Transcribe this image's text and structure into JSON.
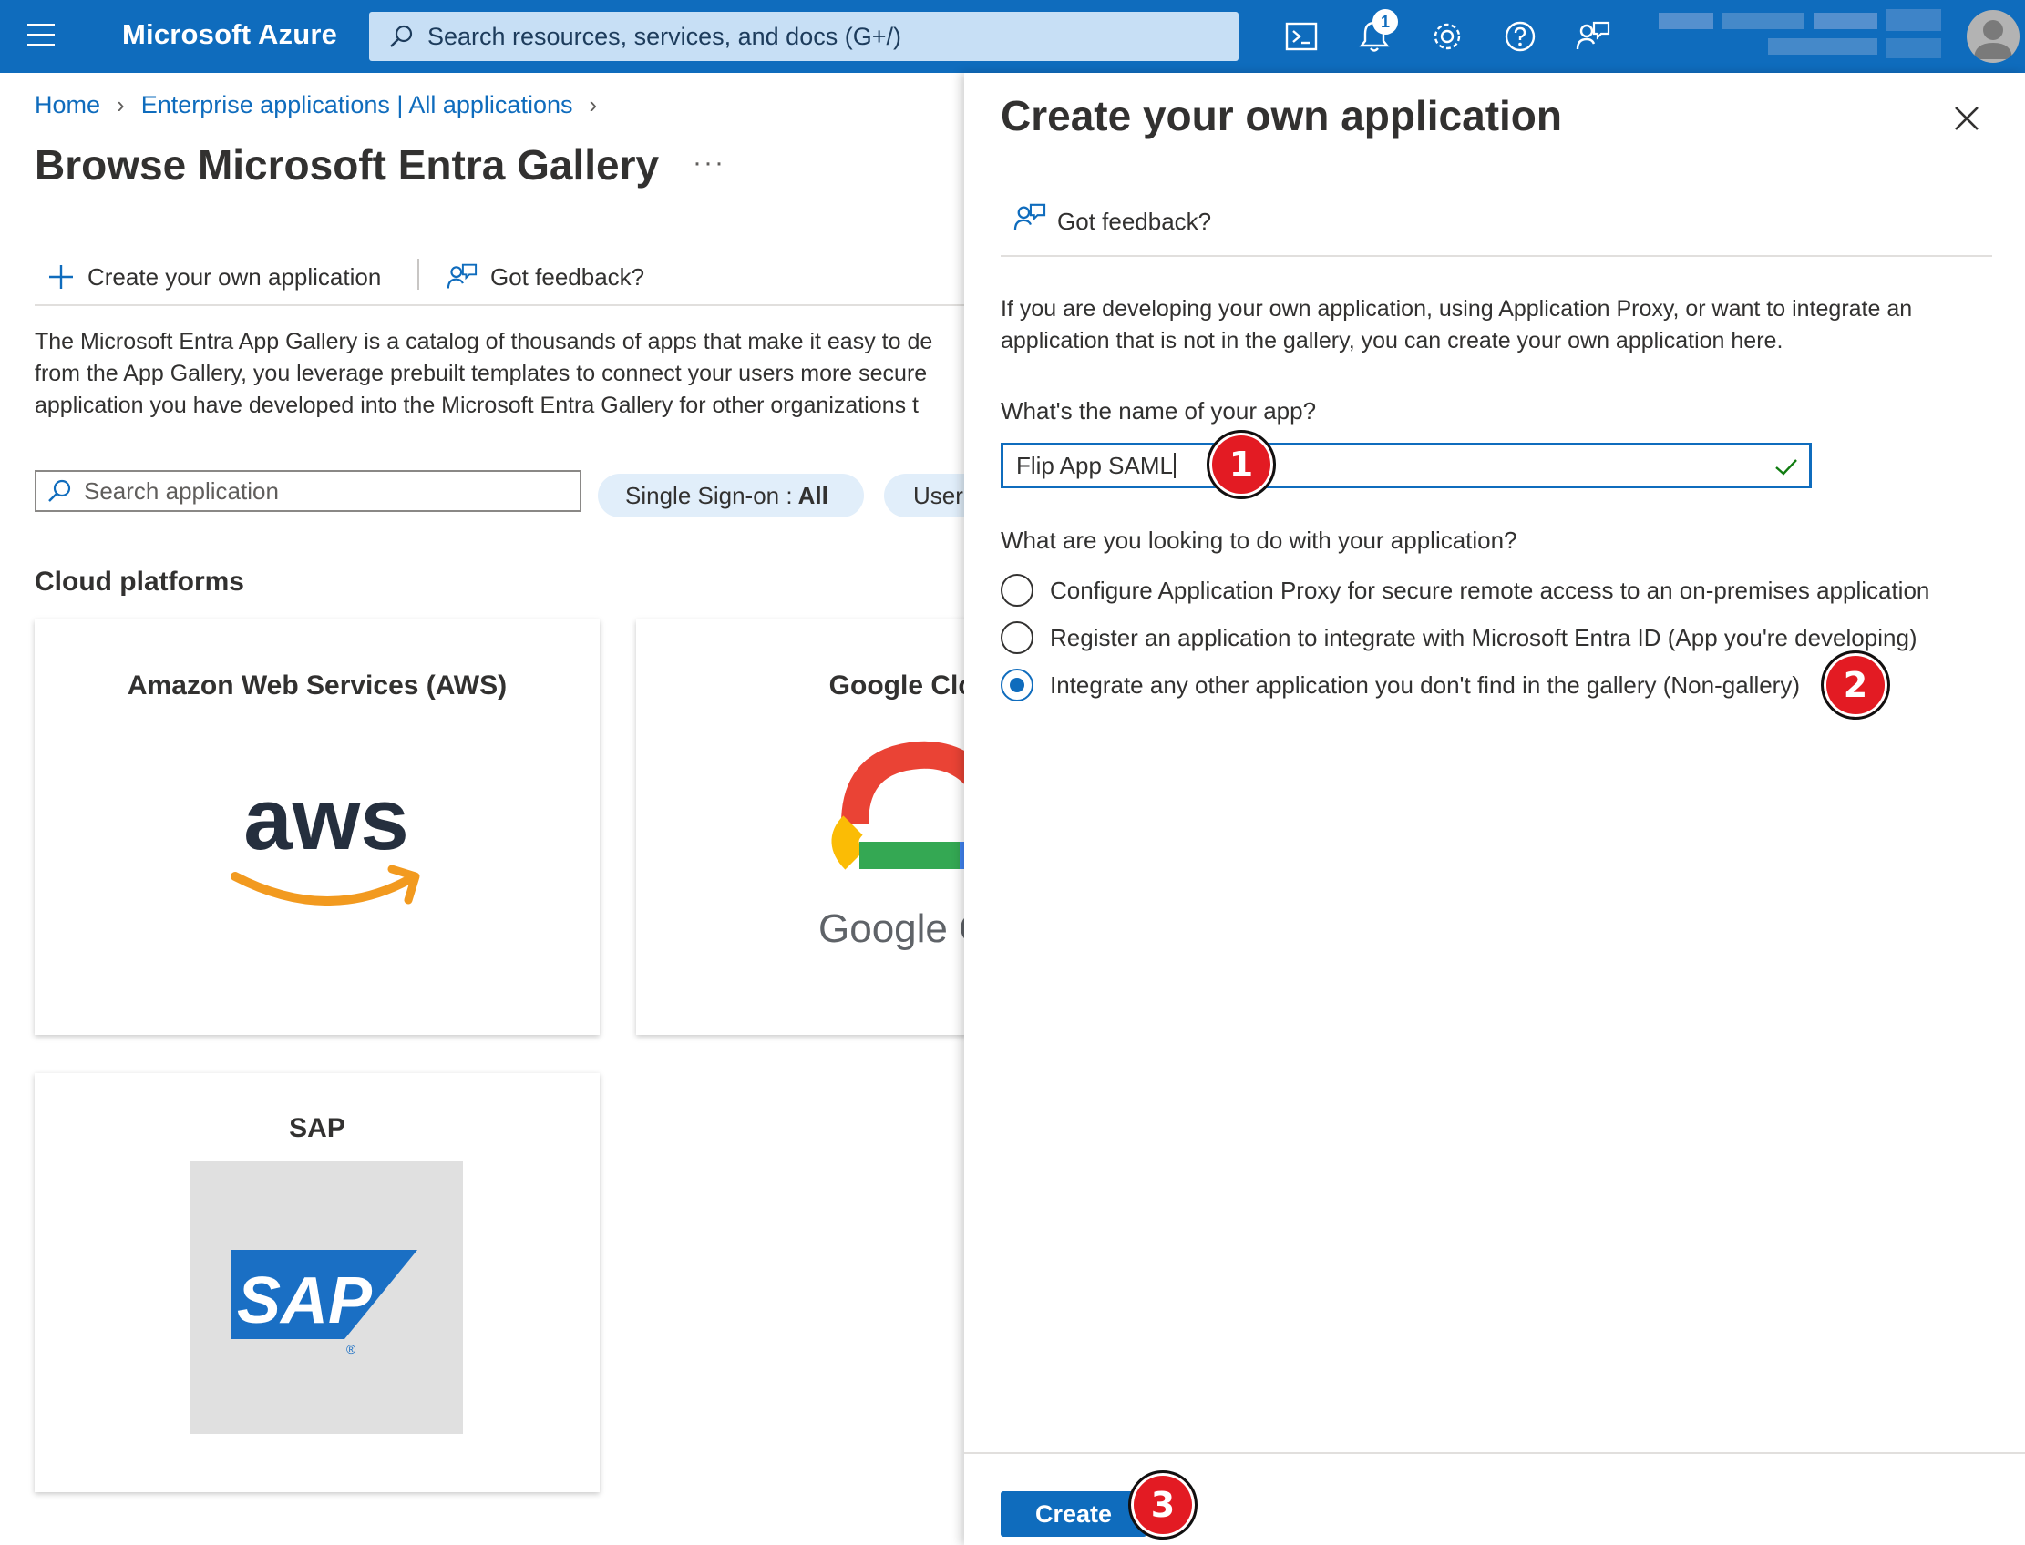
{
  "topbar": {
    "brand": "Microsoft Azure",
    "search_placeholder": "Search resources, services, and docs (G+/)",
    "notification_count": "1",
    "icons": [
      "hamburger-menu-icon",
      "cloud-shell-icon",
      "bell-icon",
      "gear-icon",
      "help-icon",
      "feedback-icon",
      "avatar-icon"
    ]
  },
  "breadcrumb": {
    "home": "Home",
    "enterprise": "Enterprise applications | All applications"
  },
  "page": {
    "title": "Browse Microsoft Entra Gallery",
    "more": "···",
    "create_own": "Create your own application",
    "got_feedback": "Got feedback?",
    "description": [
      "The Microsoft Entra App Gallery is a catalog of thousands of apps that make it easy to de",
      "from the App Gallery, you leverage prebuilt templates to connect your users more secure",
      "application you have developed into the Microsoft Entra Gallery for other organizations t"
    ],
    "search_placeholder": "Search application",
    "filters": {
      "sso_label": "Single Sign-on : ",
      "sso_value": "All",
      "user": "User"
    },
    "section": "Cloud platforms",
    "cards": [
      {
        "title": "Amazon Web Services (AWS)",
        "logo_text": "aws"
      },
      {
        "title": "Google Cloud",
        "logo_text": "Google C"
      },
      {
        "title": "SAP",
        "logo_text": "SAP"
      }
    ]
  },
  "panel": {
    "title": "Create your own application",
    "got_feedback": "Got feedback?",
    "description": "If you are developing your own application, using Application Proxy, or want to integrate an application that is not in the gallery, you can create your own application here.",
    "name_label": "What's the name of your app?",
    "name_value": "Flip App SAML",
    "purpose_label": "What are you looking to do with your application?",
    "options": [
      {
        "label": "Configure Application Proxy for secure remote access to an on-premises application",
        "selected": false
      },
      {
        "label": "Register an application to integrate with Microsoft Entra ID (App you're developing)",
        "selected": false
      },
      {
        "label": "Integrate any other application you don't find in the gallery (Non-gallery)",
        "selected": true
      }
    ],
    "create_label": "Create"
  },
  "steps": [
    "1",
    "2",
    "3"
  ],
  "colors": {
    "azure_blue": "#0f6cbd",
    "step_red": "#e31b23",
    "aws_orange": "#f29a1f",
    "aws_navy": "#252f3e",
    "sap_blue": "#1a6fc4"
  }
}
